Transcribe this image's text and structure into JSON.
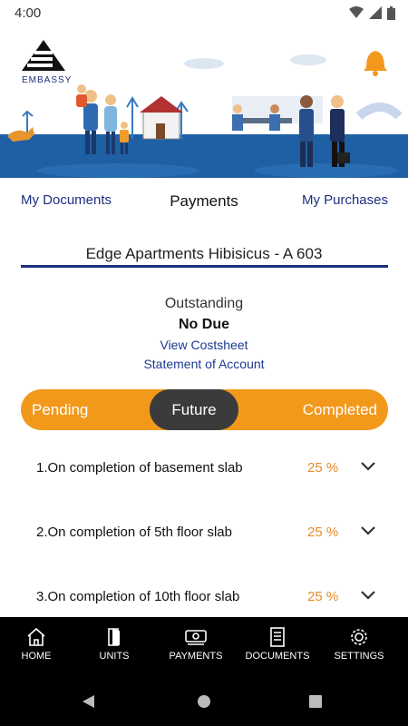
{
  "status_bar": {
    "time": "4:00"
  },
  "brand": {
    "logo_text": "EMBASSY"
  },
  "nav": {
    "my_documents": "My Documents",
    "payments": "Payments",
    "my_purchases": "My Purchases"
  },
  "unit": {
    "title": "Edge Apartments Hibisicus - A 603"
  },
  "summary": {
    "outstanding_label": "Outstanding",
    "outstanding_value": "No Due",
    "view_costsheet": "View Costsheet",
    "statement": "Statement of Account"
  },
  "tabs": {
    "pending": "Pending",
    "future": "Future",
    "completed": "Completed",
    "selected": "Future"
  },
  "milestones": [
    {
      "label": "1.On completion of basement slab",
      "percent": "25 %"
    },
    {
      "label": "2.On completion of 5th floor slab",
      "percent": "25 %"
    },
    {
      "label": "3.On completion of 10th floor slab",
      "percent": "25 %"
    }
  ],
  "bottom_nav": [
    {
      "label": "HOME",
      "icon": "home-icon"
    },
    {
      "label": "UNITS",
      "icon": "door-icon"
    },
    {
      "label": "PAYMENTS",
      "icon": "money-icon"
    },
    {
      "label": "DOCUMENTS",
      "icon": "document-icon"
    },
    {
      "label": "SETTINGS",
      "icon": "gear-icon"
    }
  ],
  "colors": {
    "accent_orange": "#f2991c",
    "navy": "#1d2f7f",
    "selected_tab": "#3b3b3b",
    "percent_orange": "#e78b25"
  }
}
